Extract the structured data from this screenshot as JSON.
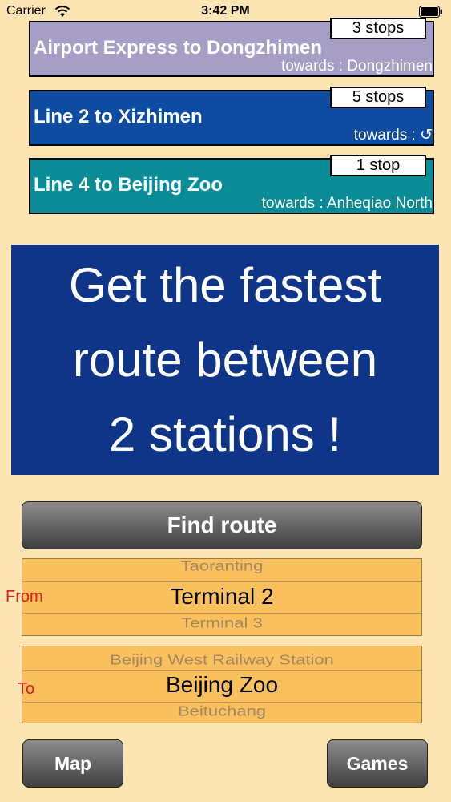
{
  "status_bar": {
    "carrier": "Carrier",
    "time": "3:42 PM"
  },
  "routes": [
    {
      "title": "Airport Express to Dongzhimen",
      "towards": "towards : Dongzhimen",
      "stops": "3 stops",
      "color": "#a69ec4"
    },
    {
      "title": "Line 2 to Xizhimen",
      "towards": "towards : ↺",
      "stops": "5 stops",
      "color": "#0e4ca1"
    },
    {
      "title": "Line 4 to Beijing Zoo",
      "towards": "towards : Anheqiao North",
      "stops": "1 stop",
      "color": "#0a8c96"
    }
  ],
  "promo": {
    "line1": "Get the fastest",
    "line2": "route between",
    "line3": "2 stations !",
    "color": "#0e3587"
  },
  "find_route": {
    "label": "Find route"
  },
  "from_picker": {
    "label": "From",
    "above": "Taoranting",
    "selected": "Terminal 2",
    "below": "Terminal 3"
  },
  "to_picker": {
    "label": "To",
    "above": "Beijing West Railway Station",
    "selected": "Beijing Zoo",
    "below": "Beituchang"
  },
  "bottom": {
    "map_label": "Map",
    "games_label": "Games"
  }
}
